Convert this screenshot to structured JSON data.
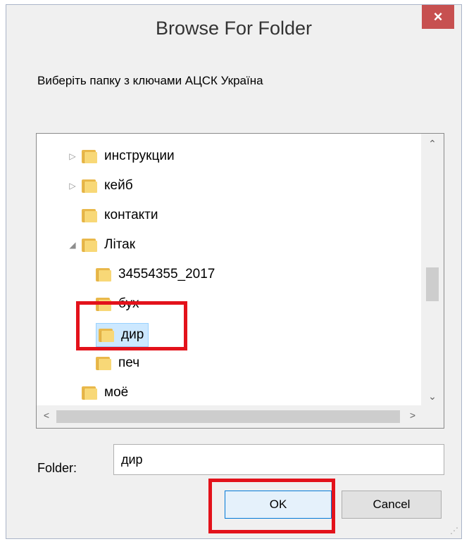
{
  "window": {
    "title": "Browse For Folder",
    "close_glyph": "×"
  },
  "instruction": "Виберіть папку з ключами АЦСК Україна",
  "tree": {
    "items": [
      {
        "label": "инструкции",
        "expander": "▷"
      },
      {
        "label": "кейб",
        "expander": "▷"
      },
      {
        "label": "контакти",
        "expander": ""
      },
      {
        "label": "Літак",
        "expander": "◢"
      },
      {
        "label": "34554355_2017",
        "expander": ""
      },
      {
        "label": "бух",
        "expander": ""
      },
      {
        "label": "дир",
        "expander": "",
        "selected": true
      },
      {
        "label": "печ",
        "expander": ""
      },
      {
        "label": "моё",
        "expander": ""
      }
    ],
    "scroll_up": "⌃",
    "scroll_down": "⌄",
    "scroll_left": "<",
    "scroll_right": ">"
  },
  "folder_field": {
    "label": "Folder:",
    "value": "дир"
  },
  "buttons": {
    "ok": "OK",
    "cancel": "Cancel"
  },
  "icons": {
    "folder": "folder-icon",
    "close": "close-icon"
  },
  "colors": {
    "highlight": "#e3121b",
    "selection": "#cce8ff",
    "close_button": "#c75050"
  }
}
